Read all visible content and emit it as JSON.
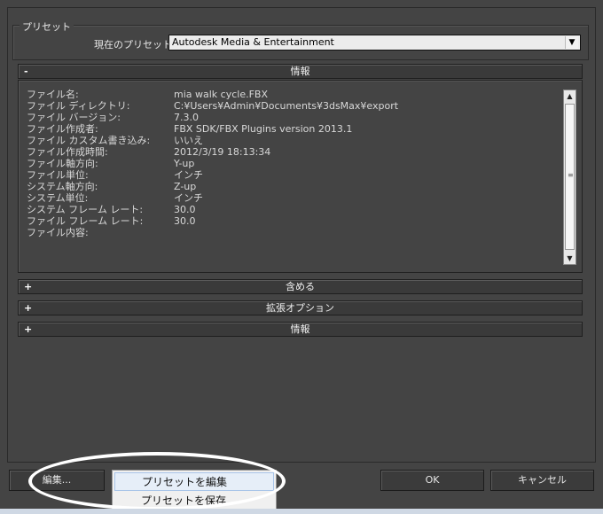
{
  "preset_group": {
    "title": "プリセット",
    "current_label": "現在のプリセット:",
    "current_value": "Autodesk Media & Entertainment"
  },
  "info_rollout": {
    "sign": "-",
    "title": "情報",
    "rows": [
      {
        "key": "ファイル名:",
        "value": "mia walk cycle.FBX"
      },
      {
        "key": "ファイル ディレクトリ:",
        "value": "C:¥Users¥Admin¥Documents¥3dsMax¥export"
      },
      {
        "key": "ファイル バージョン:",
        "value": "7.3.0"
      },
      {
        "key": "ファイル作成者:",
        "value": "FBX SDK/FBX Plugins version 2013.1"
      },
      {
        "key": "ファイル カスタム書き込み:",
        "value": "いいえ"
      },
      {
        "key": "ファイル作成時間:",
        "value": "2012/3/19  18:13:34"
      },
      {
        "key": "ファイル軸方向:",
        "value": "Y-up"
      },
      {
        "key": "ファイル単位:",
        "value": "インチ"
      },
      {
        "key": "システム軸方向:",
        "value": "Z-up"
      },
      {
        "key": "システム単位:",
        "value": "インチ"
      },
      {
        "key": "システム フレーム レート:",
        "value": "30.0"
      },
      {
        "key": "ファイル フレーム レート:",
        "value": "30.0"
      },
      {
        "key": "ファイル内容:",
        "value": ""
      }
    ]
  },
  "rollouts": [
    {
      "sign": "+",
      "title": "含める"
    },
    {
      "sign": "+",
      "title": "拡張オプション"
    },
    {
      "sign": "+",
      "title": "情報"
    }
  ],
  "buttons": {
    "edit": "編集...",
    "ok": "OK",
    "cancel": "キャンセル"
  },
  "context_menu": {
    "items": [
      "プリセットを編集",
      "プリセットを保存"
    ]
  }
}
